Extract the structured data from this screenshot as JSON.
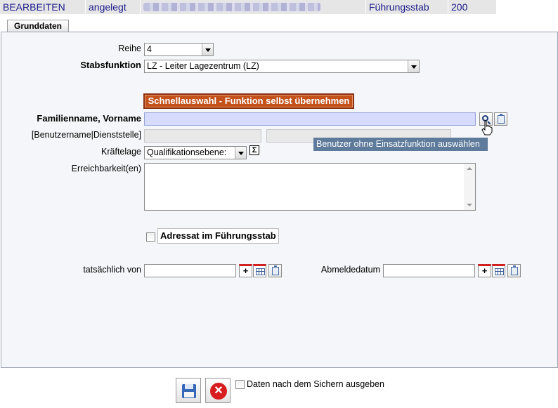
{
  "header": {
    "mode": "BEARBEITEN",
    "status": "angelegt",
    "group": "Führungsstab",
    "number": "200"
  },
  "tabs": {
    "active": "Grunddaten"
  },
  "form": {
    "reihe_label": "Reihe",
    "reihe_value": "4",
    "stabsfunktion_label": "Stabsfunktion",
    "stabsfunktion_value": "LZ - Leiter Lagezentrum (LZ)",
    "quick_select_label": "Schnellauswahl - Funktion selbst übernehmen",
    "name_label": "Familienname, Vorname",
    "user_label": "[Benutzername|Dienststelle]",
    "tooltip": "Benutzer ohne Einsatzfunktion auswählen",
    "kraeftelage_label": "Kräftelage",
    "kraeftelage_value": "Qualifikationsebene:",
    "erreichbarkeit_label": "Erreichbarkeit(en)",
    "adressat_label": "Adressat im Führungsstab",
    "von_label": "tatsächlich von",
    "abmelde_label": "Abmeldedatum"
  },
  "footer": {
    "print_label": "Daten nach dem Sichern ausgeben"
  },
  "colors": {
    "header_text": "#1a1a8a",
    "quick_select_bg": "#c4501a",
    "tooltip_bg": "#5f7b9b",
    "name_field_bg": "#d7dcff"
  },
  "icons": [
    "search-icon",
    "clipboard-icon",
    "sigma-icon",
    "plus-icon",
    "calendar-icon",
    "save-icon",
    "cancel-icon",
    "hand-cursor-icon"
  ]
}
